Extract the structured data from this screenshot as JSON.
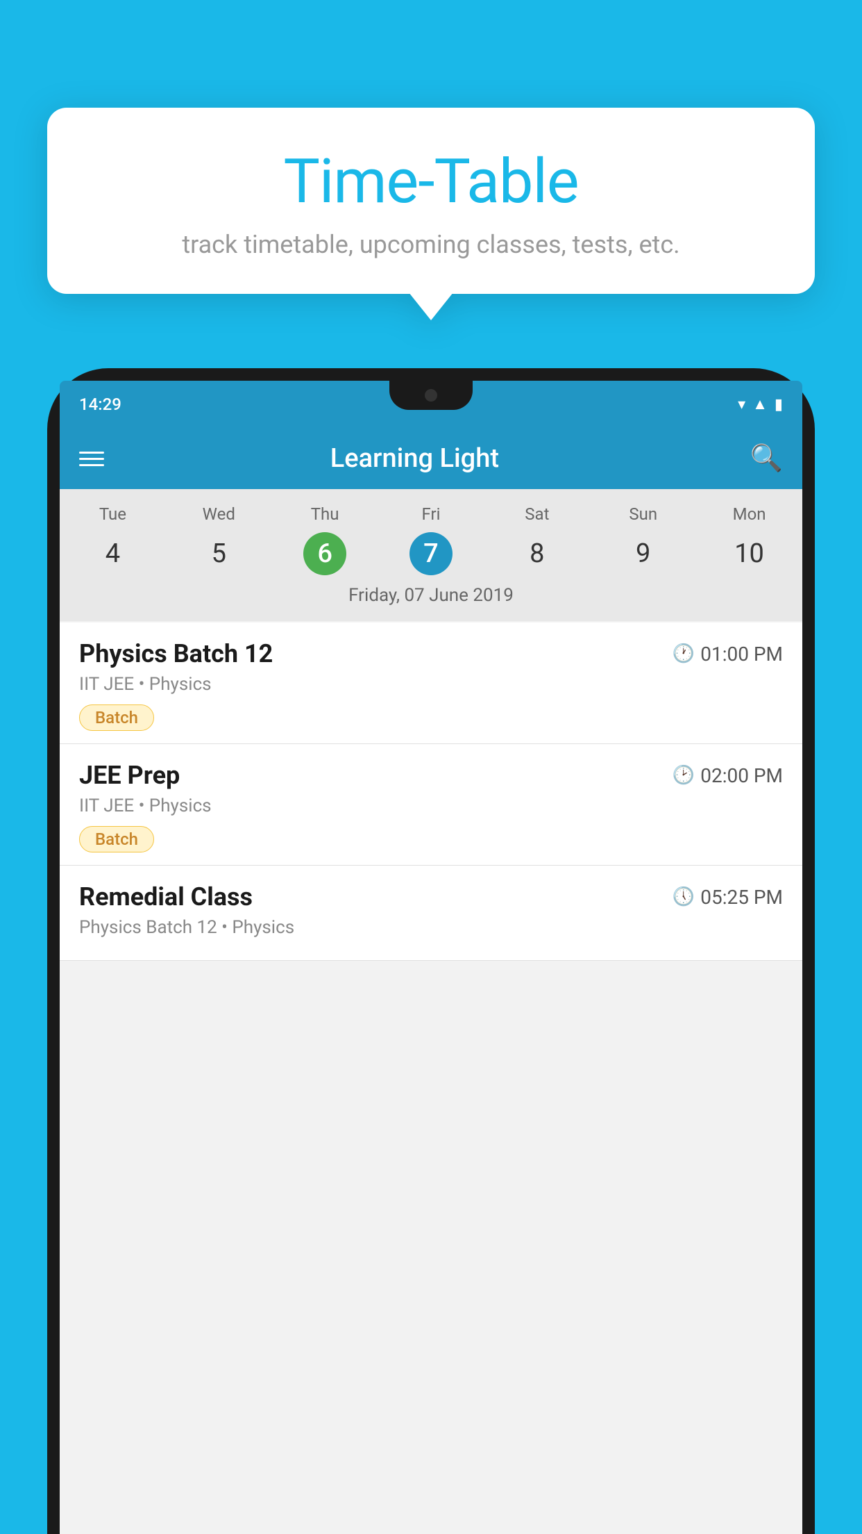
{
  "background": {
    "color": "#1AB8E8"
  },
  "tooltip": {
    "title": "Time-Table",
    "subtitle": "track timetable, upcoming classes, tests, etc."
  },
  "phone": {
    "status_bar": {
      "time": "14:29"
    },
    "app_bar": {
      "title": "Learning Light"
    },
    "calendar": {
      "days": [
        "Tue",
        "Wed",
        "Thu",
        "Fri",
        "Sat",
        "Sun",
        "Mon"
      ],
      "dates": [
        "4",
        "5",
        "6",
        "7",
        "8",
        "9",
        "10"
      ],
      "today_index": 2,
      "selected_index": 3,
      "selected_label": "Friday, 07 June 2019"
    },
    "schedule": [
      {
        "title": "Physics Batch 12",
        "time": "01:00 PM",
        "meta": "IIT JEE • Physics",
        "tag": "Batch"
      },
      {
        "title": "JEE Prep",
        "time": "02:00 PM",
        "meta": "IIT JEE • Physics",
        "tag": "Batch"
      },
      {
        "title": "Remedial Class",
        "time": "05:25 PM",
        "meta": "Physics Batch 12 • Physics",
        "tag": ""
      }
    ]
  }
}
